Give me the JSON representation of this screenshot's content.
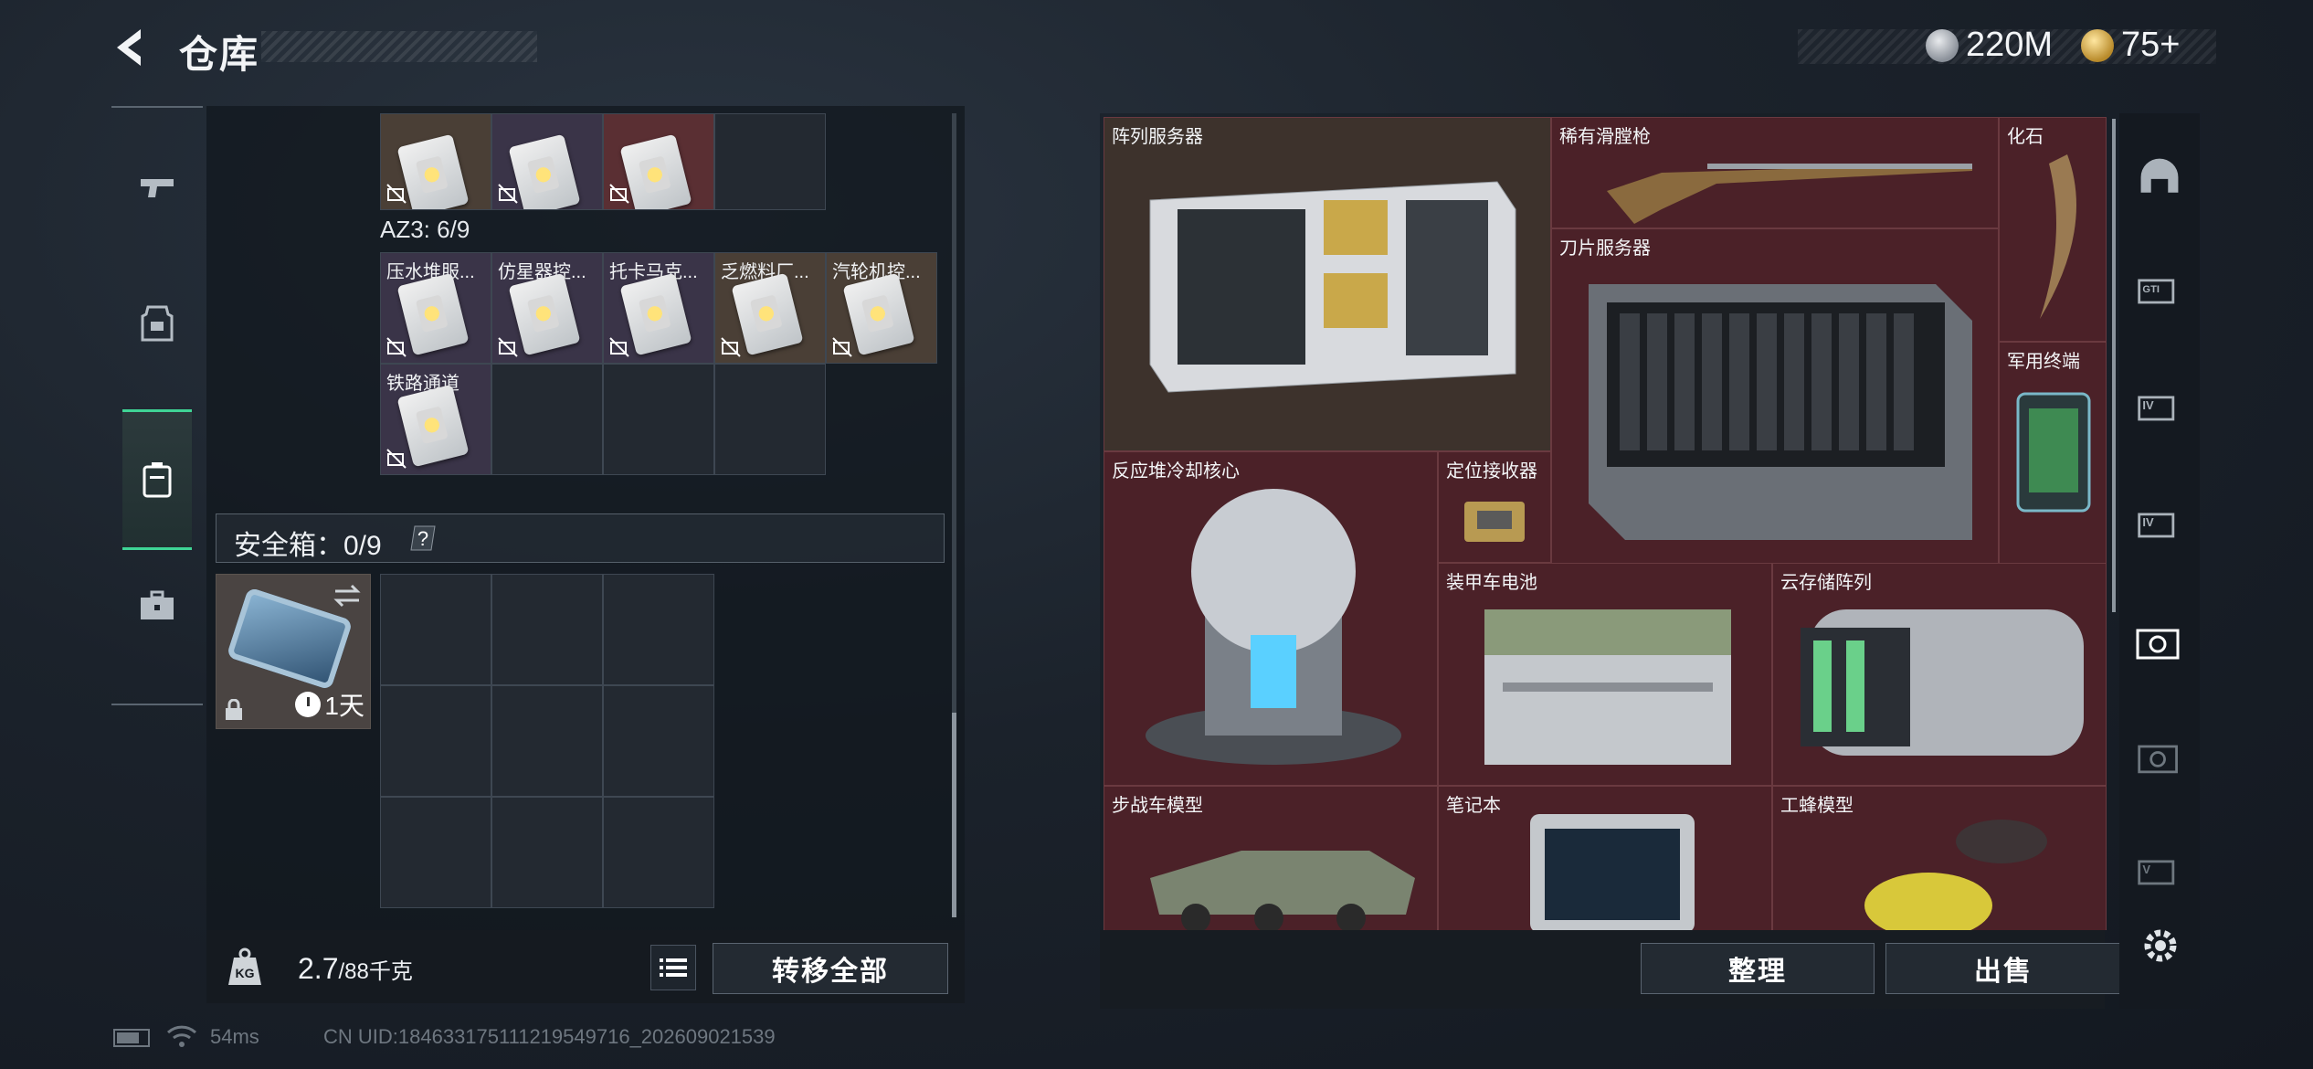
{
  "header": {
    "title": "仓库",
    "currencies": [
      {
        "icon": "silver-coin-icon",
        "value": "220M"
      },
      {
        "icon": "gold-coin-icon",
        "value": "75+"
      }
    ]
  },
  "left_nav": {
    "items": [
      {
        "name": "weapons",
        "icon": "pistol-icon"
      },
      {
        "name": "equipment",
        "icon": "vest-icon"
      },
      {
        "name": "backpack",
        "icon": "backpack-icon",
        "active": true
      },
      {
        "name": "case",
        "icon": "briefcase-icon"
      }
    ]
  },
  "container": {
    "top_row": [
      {
        "label": "",
        "color": "brown"
      },
      {
        "label": "",
        "color": "purple"
      },
      {
        "label": "",
        "color": "red"
      },
      {
        "label": "",
        "color": "empty"
      }
    ],
    "az3_label": "AZ3: 6/9",
    "az3_items": [
      {
        "label": "压水堆服...",
        "color": "purple"
      },
      {
        "label": "仿星器控...",
        "color": "purple"
      },
      {
        "label": "托卡马克...",
        "color": "purple"
      },
      {
        "label": "乏燃料厂...",
        "color": "brown"
      },
      {
        "label": "汽轮机控...",
        "color": "brown"
      },
      {
        "label": "铁路通道",
        "color": "purple"
      }
    ],
    "safebox": {
      "label": "安全箱：0/9",
      "help": "?",
      "item_timer": "1天"
    }
  },
  "footer_left": {
    "kg_label": "KG",
    "weight_current": "2.7",
    "weight_max": "/88千克",
    "transfer_all": "转移全部"
  },
  "stash": {
    "items": [
      {
        "label": "阵列服务器"
      },
      {
        "label": "稀有滑膛枪"
      },
      {
        "label": "化石"
      },
      {
        "label": "刀片服务器"
      },
      {
        "label": "军用终端"
      },
      {
        "label": "反应堆冷却核心"
      },
      {
        "label": "定位接收器"
      },
      {
        "label": "装甲车电池"
      },
      {
        "label": "云存储阵列"
      },
      {
        "label": "步战车模型"
      },
      {
        "label": "笔记本"
      },
      {
        "label": "工蜂模型"
      }
    ],
    "sort_button": "整理",
    "sell_button": "出售"
  },
  "right_nav": {
    "items": [
      {
        "icon": "dome-icon"
      },
      {
        "icon": "gti-tag-icon"
      },
      {
        "icon": "level-iv-tag-icon"
      },
      {
        "icon": "level-iv-tag-icon"
      },
      {
        "icon": "valuables-icon",
        "active": true
      },
      {
        "icon": "valuables-icon"
      },
      {
        "icon": "level-v-tag-icon"
      }
    ],
    "settings_icon": "gear-icon"
  },
  "status_bar": {
    "ping": "54ms",
    "uid": "CN UID:18463317511121954971​6_202609021539"
  },
  "colors": {
    "accent_green": "#3fd596",
    "rarity_red": "#4b2128",
    "rarity_brown": "#3d322c",
    "rarity_purple": "#3a3448"
  }
}
